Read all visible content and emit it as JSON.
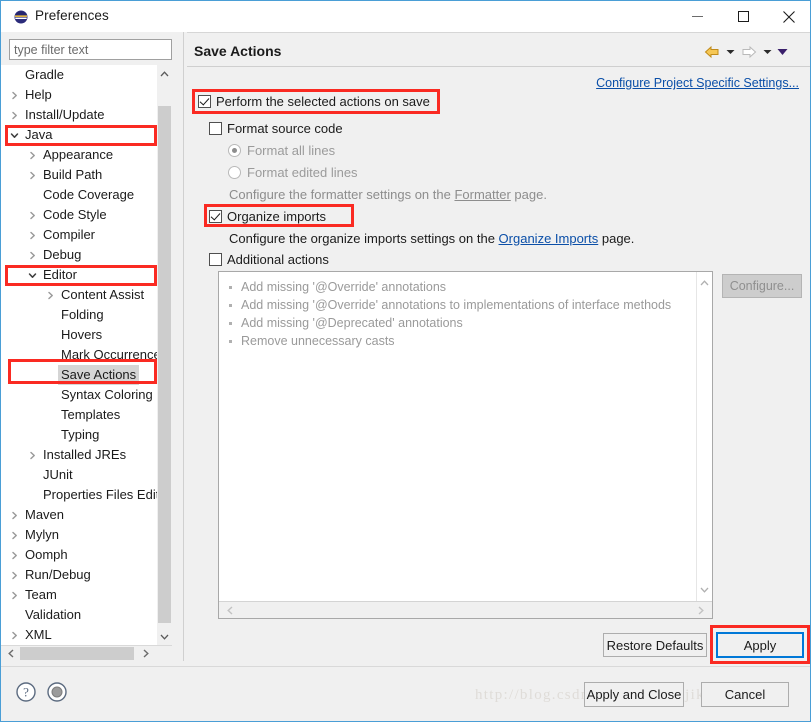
{
  "window": {
    "title": "Preferences",
    "app_icon": "eclipse-icon",
    "controls": {
      "minimize": "minimize-icon",
      "maximize": "maximize-icon",
      "close": "close-icon"
    }
  },
  "sidebar": {
    "filter": {
      "placeholder": "type filter text",
      "value": ""
    },
    "items": [
      {
        "label": "Gradle",
        "indent": 1,
        "twisty": "none",
        "selected": false
      },
      {
        "label": "Help",
        "indent": 1,
        "twisty": "collapsed",
        "selected": false
      },
      {
        "label": "Install/Update",
        "indent": 1,
        "twisty": "collapsed",
        "selected": false
      },
      {
        "label": "Java",
        "indent": 1,
        "twisty": "expanded",
        "selected": false
      },
      {
        "label": "Appearance",
        "indent": 2,
        "twisty": "collapsed",
        "selected": false
      },
      {
        "label": "Build Path",
        "indent": 2,
        "twisty": "collapsed",
        "selected": false
      },
      {
        "label": "Code Coverage",
        "indent": 2,
        "twisty": "none",
        "selected": false
      },
      {
        "label": "Code Style",
        "indent": 2,
        "twisty": "collapsed",
        "selected": false
      },
      {
        "label": "Compiler",
        "indent": 2,
        "twisty": "collapsed",
        "selected": false
      },
      {
        "label": "Debug",
        "indent": 2,
        "twisty": "collapsed",
        "selected": false
      },
      {
        "label": "Editor",
        "indent": 2,
        "twisty": "expanded",
        "selected": false
      },
      {
        "label": "Content Assist",
        "indent": 3,
        "twisty": "collapsed",
        "selected": false
      },
      {
        "label": "Folding",
        "indent": 3,
        "twisty": "none",
        "selected": false
      },
      {
        "label": "Hovers",
        "indent": 3,
        "twisty": "none",
        "selected": false
      },
      {
        "label": "Mark Occurrences",
        "indent": 3,
        "twisty": "none",
        "selected": false
      },
      {
        "label": "Save Actions",
        "indent": 3,
        "twisty": "none",
        "selected": true
      },
      {
        "label": "Syntax Coloring",
        "indent": 3,
        "twisty": "none",
        "selected": false
      },
      {
        "label": "Templates",
        "indent": 3,
        "twisty": "none",
        "selected": false
      },
      {
        "label": "Typing",
        "indent": 3,
        "twisty": "none",
        "selected": false
      },
      {
        "label": "Installed JREs",
        "indent": 2,
        "twisty": "collapsed",
        "selected": false
      },
      {
        "label": "JUnit",
        "indent": 2,
        "twisty": "none",
        "selected": false
      },
      {
        "label": "Properties Files Editor",
        "indent": 2,
        "twisty": "none",
        "selected": false
      },
      {
        "label": "Maven",
        "indent": 1,
        "twisty": "collapsed",
        "selected": false
      },
      {
        "label": "Mylyn",
        "indent": 1,
        "twisty": "collapsed",
        "selected": false
      },
      {
        "label": "Oomph",
        "indent": 1,
        "twisty": "collapsed",
        "selected": false
      },
      {
        "label": "Run/Debug",
        "indent": 1,
        "twisty": "collapsed",
        "selected": false
      },
      {
        "label": "Team",
        "indent": 1,
        "twisty": "collapsed",
        "selected": false
      },
      {
        "label": "Validation",
        "indent": 1,
        "twisty": "none",
        "selected": false
      },
      {
        "label": "XML",
        "indent": 1,
        "twisty": "collapsed",
        "selected": false
      }
    ]
  },
  "page": {
    "title": "Save Actions",
    "configure_project_link": "Configure Project Specific Settings...",
    "nav": {
      "back_icon": "back-arrow-icon",
      "back_menu_icon": "chevron-down-icon",
      "forward_icon": "forward-arrow-icon",
      "forward_menu_icon": "chevron-down-icon",
      "view_menu_icon": "view-menu-icon"
    },
    "perform_on_save": {
      "label": "Perform the selected actions on save",
      "checked": true
    },
    "format_source": {
      "label": "Format source code",
      "checked": false
    },
    "format_all_lines": {
      "label": "Format all lines",
      "selected": true
    },
    "format_edited_lines": {
      "label": "Format edited lines",
      "selected": false
    },
    "formatter_hint": {
      "prefix": "Configure the formatter settings on the ",
      "link": "Formatter",
      "suffix": " page."
    },
    "organize_imports": {
      "label": "Organize imports",
      "checked": true
    },
    "organize_hint": {
      "prefix": "Configure the organize imports settings on the ",
      "link": "Organize Imports",
      "suffix": " page."
    },
    "additional_actions": {
      "label": "Additional actions",
      "checked": false
    },
    "actions_list": [
      "Add missing '@Override' annotations",
      "Add missing '@Override' annotations to implementations of interface methods",
      "Add missing '@Deprecated' annotations",
      "Remove unnecessary casts"
    ],
    "configure_button": "Configure..."
  },
  "buttons": {
    "restore_defaults": "Restore Defaults",
    "apply": "Apply",
    "apply_and_close": "Apply and Close",
    "cancel": "Cancel"
  },
  "footer": {
    "help_icon": "help-icon",
    "shell_icon": "oomph-shell-icon",
    "watermark": "http://blog.csdn.net/yuanfai_jike"
  },
  "colors": {
    "accent": "#0078d7",
    "annotation": "#fa2a22",
    "link": "#0b4fa8",
    "window_border": "#4a9ed6",
    "panel_bg": "#f0f0f0",
    "selection": "#d5d5d5"
  }
}
